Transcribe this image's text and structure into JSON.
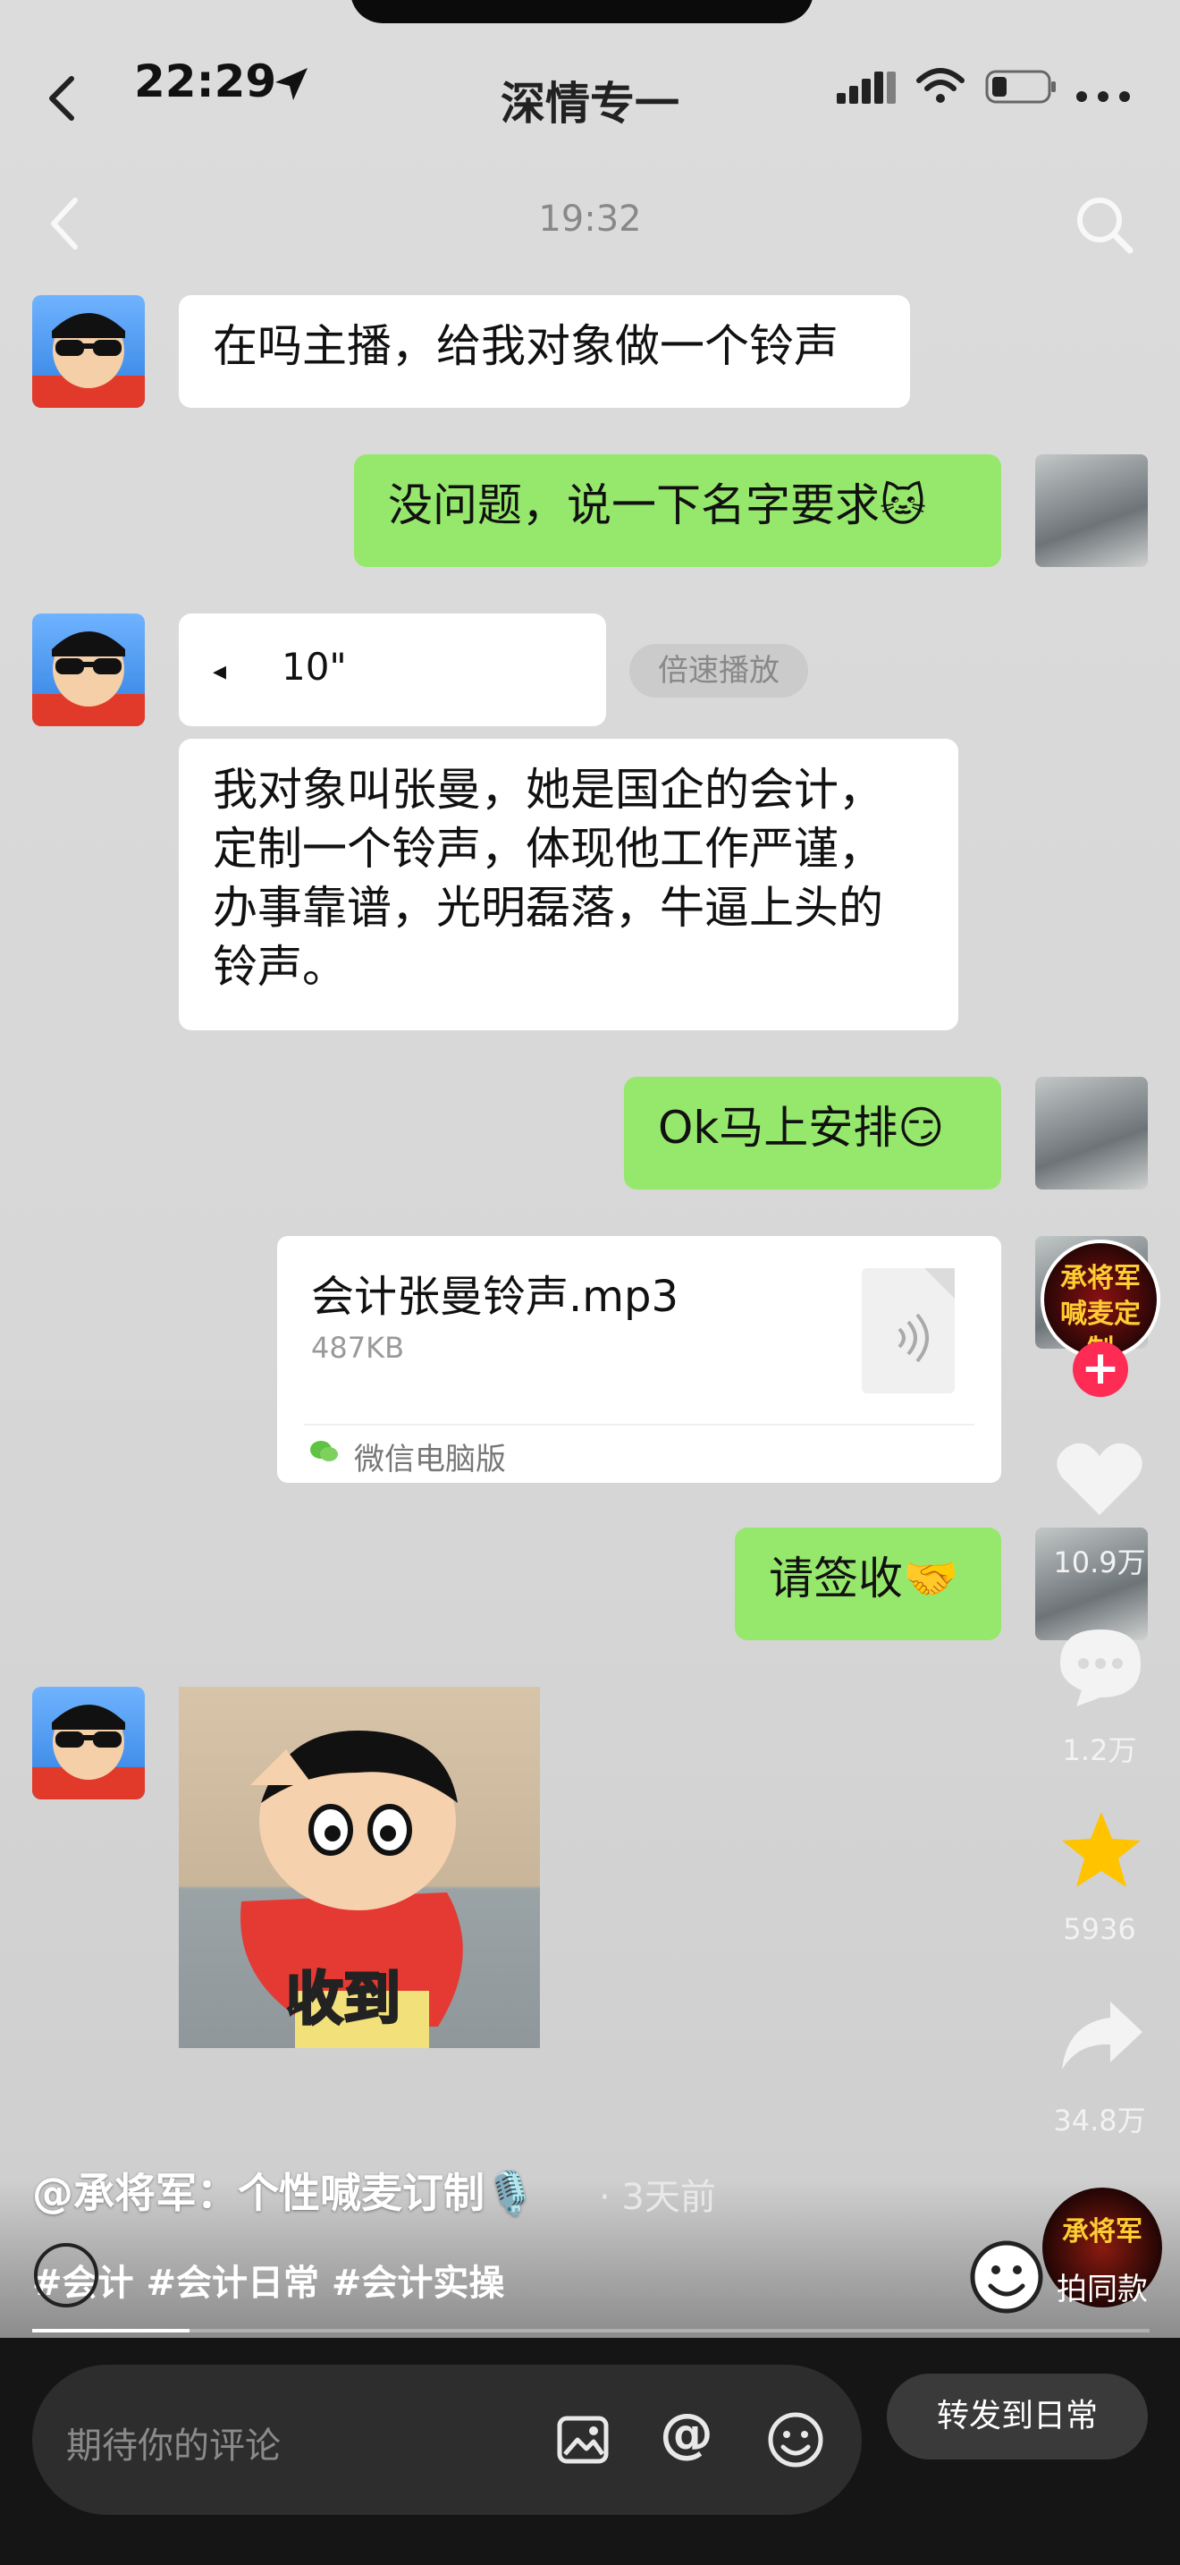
{
  "status_bar": {
    "time": "22:29",
    "signal": "....ll",
    "battery": "▭"
  },
  "chat": {
    "contact_name": "深情专一",
    "timestamp": "19:32",
    "messages": [
      {
        "side": "left",
        "text": "在吗主播，给我对象做一个铃声"
      },
      {
        "side": "right",
        "text": "没问题，说一下名字要求🐱"
      },
      {
        "side": "left",
        "type": "voice",
        "duration": "10\"",
        "speed_label": "倍速播放"
      },
      {
        "side": "left",
        "text": "我对象叫张曼，她是国企的会计，定制一个铃声，体现他工作严谨，办事靠谱，光明磊落，牛逼上头的铃声。"
      },
      {
        "side": "right",
        "text": "Ok马上安排😏"
      },
      {
        "side": "right",
        "type": "file",
        "filename": "会计张曼铃声.mp3",
        "size": "487KB",
        "source": "微信电脑版"
      },
      {
        "side": "right",
        "text": "请签收🤝"
      },
      {
        "side": "left",
        "type": "sticker",
        "caption": "收到"
      }
    ]
  },
  "sidebar": {
    "creator_avatar_text": "承将军喊麦定制",
    "likes": "10.9万",
    "comments": "1.2万",
    "favorites": "5936",
    "shares": "34.8万",
    "same_style_label": "拍同款",
    "music_disc_text": "承将军"
  },
  "caption": {
    "author": "@承将军：个性喊麦订制🎙️",
    "time_ago": "· 3天前",
    "hashtags": "#会计 #会计日常 #会计实操"
  },
  "comment_bar": {
    "placeholder": "期待你的评论",
    "forward_label": "转发到日常"
  },
  "colors": {
    "green_bubble": "#96e86c",
    "white_bubble": "#ffffff",
    "like_red": "#fe2c55",
    "star": "#ffc300"
  }
}
